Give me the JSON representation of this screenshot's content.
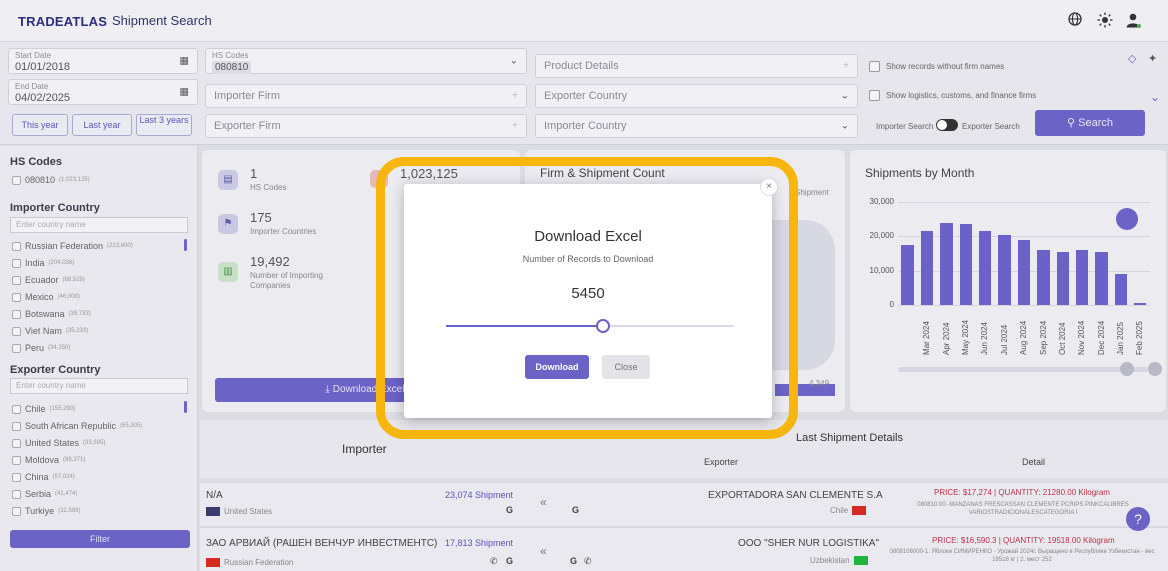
{
  "header": {
    "logo": "TRADEATLAS",
    "title": "Shipment Search",
    "icons": [
      "globe-icon",
      "sun-icon",
      "user-icon"
    ]
  },
  "filters": {
    "start_date_label": "Start Date",
    "start_date": "01/01/2018",
    "end_date_label": "End Date",
    "end_date": "04/02/2025",
    "quick": [
      "This year",
      "Last year",
      "Last 3 years"
    ],
    "hs_codes_label": "HS Codes",
    "hs_code_chip": "080810",
    "importer_firm_ph": "Importer Firm",
    "exporter_firm_ph": "Exporter Firm",
    "product_details_ph": "Product Details",
    "exporter_country_ph": "Exporter Country",
    "importer_country_ph": "Importer Country",
    "chk_without_names": "Show records without firm names",
    "chk_logistics": "Show logistics, customs, and finance firms",
    "importer_search": "Importer Search",
    "exporter_search": "Exporter Search",
    "search_btn": "Search"
  },
  "sidebar": {
    "hs_title": "HS Codes",
    "hs_items": [
      {
        "label": "080810",
        "count": "(1,023,125)"
      }
    ],
    "importer_title": "Importer Country",
    "importer_ph": "Enter country name",
    "importer_items": [
      {
        "label": "Russian Federation",
        "count": "(223,600)"
      },
      {
        "label": "India",
        "count": "(204,036)"
      },
      {
        "label": "Ecuador",
        "count": "(68,529)"
      },
      {
        "label": "Mexico",
        "count": "(46,008)"
      },
      {
        "label": "Botswana",
        "count": "(39,783)"
      },
      {
        "label": "Viet Nam",
        "count": "(35,233)"
      },
      {
        "label": "Peru",
        "count": "(34,250)"
      }
    ],
    "exporter_title": "Exporter Country",
    "exporter_ph": "Enter country name",
    "exporter_items": [
      {
        "label": "Chile",
        "count": "(155,290)"
      },
      {
        "label": "South African Republic",
        "count": "(65,305)"
      },
      {
        "label": "United States",
        "count": "(33,695)"
      },
      {
        "label": "Moldova",
        "count": "(88,371)"
      },
      {
        "label": "China",
        "count": "(57,024)"
      },
      {
        "label": "Serbia",
        "count": "(41,474)"
      },
      {
        "label": "Turkiye",
        "count": "(32,589)"
      }
    ],
    "filter_btn": "Filter"
  },
  "stats": {
    "hs_num": "1",
    "hs_lbl": "HS Codes",
    "total_num": "1,023,125",
    "imp_countries_num": "175",
    "imp_countries_lbl": "Importer Countries",
    "imp_companies_num": "19,492",
    "imp_companies_lbl": "Number of Importing Companies",
    "download_btn": "Download Excel"
  },
  "firm_card": {
    "title": "Firm & Shipment Count",
    "toggle_lbl": "Shipment",
    "value": "4,349"
  },
  "chart_data": {
    "type": "bar",
    "title": "Shipments by Month",
    "categories": [
      "Mar 2024",
      "Apr 2024",
      "May 2024",
      "Jun 2024",
      "Jul 2024",
      "Aug 2024",
      "Sep 2024",
      "Oct 2024",
      "Nov 2024",
      "Dec 2024",
      "Jan 2025",
      "Feb 2025"
    ],
    "values": [
      17500,
      21500,
      24000,
      23500,
      21500,
      20500,
      19000,
      16000,
      15500,
      16000,
      15500,
      9000,
      500
    ],
    "bar_count_note": "",
    "ylim": [
      0,
      30000
    ],
    "yticks": [
      "30,000",
      "20,000",
      "10,000",
      "0"
    ]
  },
  "table": {
    "importer_head": "Importer",
    "last_details": "Last Shipment Details",
    "exporter_head": "Exporter",
    "detail_head": "Detail",
    "rows": [
      {
        "importer": "N/A",
        "importer_country": "United States",
        "shipments": "23,074 Shipment",
        "exporter": "EXPORTADORA SAN CLEMENTE S.A",
        "exporter_country": "Chile",
        "price": "PRICE: $17,274 | QUANTITY: 21280.00 Kilogram",
        "detail": "080810.00 -MANZANAS FRESCASSAN CLEMENTE PCRIPS PINKCALIBRES VARIOSTRADICIONALESCATEGORIA I"
      },
      {
        "importer": "ЗАО АРВИАЙ (РАШЕН ВЕНЧУР ИНВЕСТМЕНТС)",
        "importer_country": "Russian Federation",
        "shipments": "17,813 Shipment",
        "exporter": "OOO \"SHER NUR LOGISTIKA\"",
        "exporter_country": "Uzbekistan",
        "price": "PRICE: $16,590.3 | QUANTITY: 19518.00 Kilogram",
        "detail": "0808108000-1. Яблоки СИМИРЕНКО - Урожай 2024г. Выращено в Республике Узбекистан - вес 19518 кг | 2. мест 252"
      }
    ]
  },
  "modal": {
    "title": "Download Excel",
    "subtitle": "Number of Records to Download",
    "value": "5450",
    "slider_fraction": 0.545,
    "download_btn": "Download",
    "close_btn": "Close"
  }
}
